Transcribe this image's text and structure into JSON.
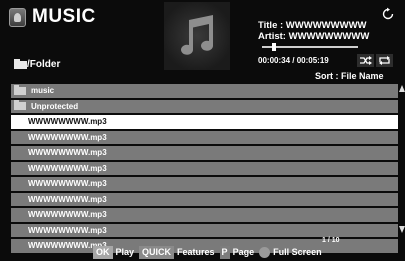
{
  "header": {
    "app_title": "MUSIC",
    "folder_path": "/Folder",
    "title_line": "Title : WWWWWWWWW",
    "artist_line": "Artist: WWWWWWWWW",
    "time_elapsed": "00:00:34",
    "time_separator": " / ",
    "time_total": "00:05:19",
    "playback_progress": 0.107,
    "sort_label": "Sort : File Name"
  },
  "list": {
    "folders": [
      "music",
      "Unprotected"
    ],
    "files": [
      "WWWWWWWW.mp3",
      "WWWWWWWW.mp3",
      "WWWWWWWW.mp3",
      "WWWWWWWW.mp3",
      "WWWWWWWW.mp3",
      "WWWWWWWW.mp3",
      "WWWWWWWW.mp3",
      "WWWWWWWW.mp3",
      "WWWWWWWW.mp3"
    ],
    "selected_index": 0,
    "page_indicator": "1 / 10"
  },
  "footer": {
    "ok_key": "OK",
    "ok_label": "Play",
    "quick_key": "QUICK",
    "quick_label": "Features",
    "p_key": "P",
    "p_label": "Page",
    "circle_label": "Full Screen"
  },
  "icons": {
    "app": "music-app-icon",
    "album": "music-note-icon",
    "refresh": "refresh-icon",
    "shuffle": "shuffle-icon",
    "repeat": "repeat-icon"
  }
}
